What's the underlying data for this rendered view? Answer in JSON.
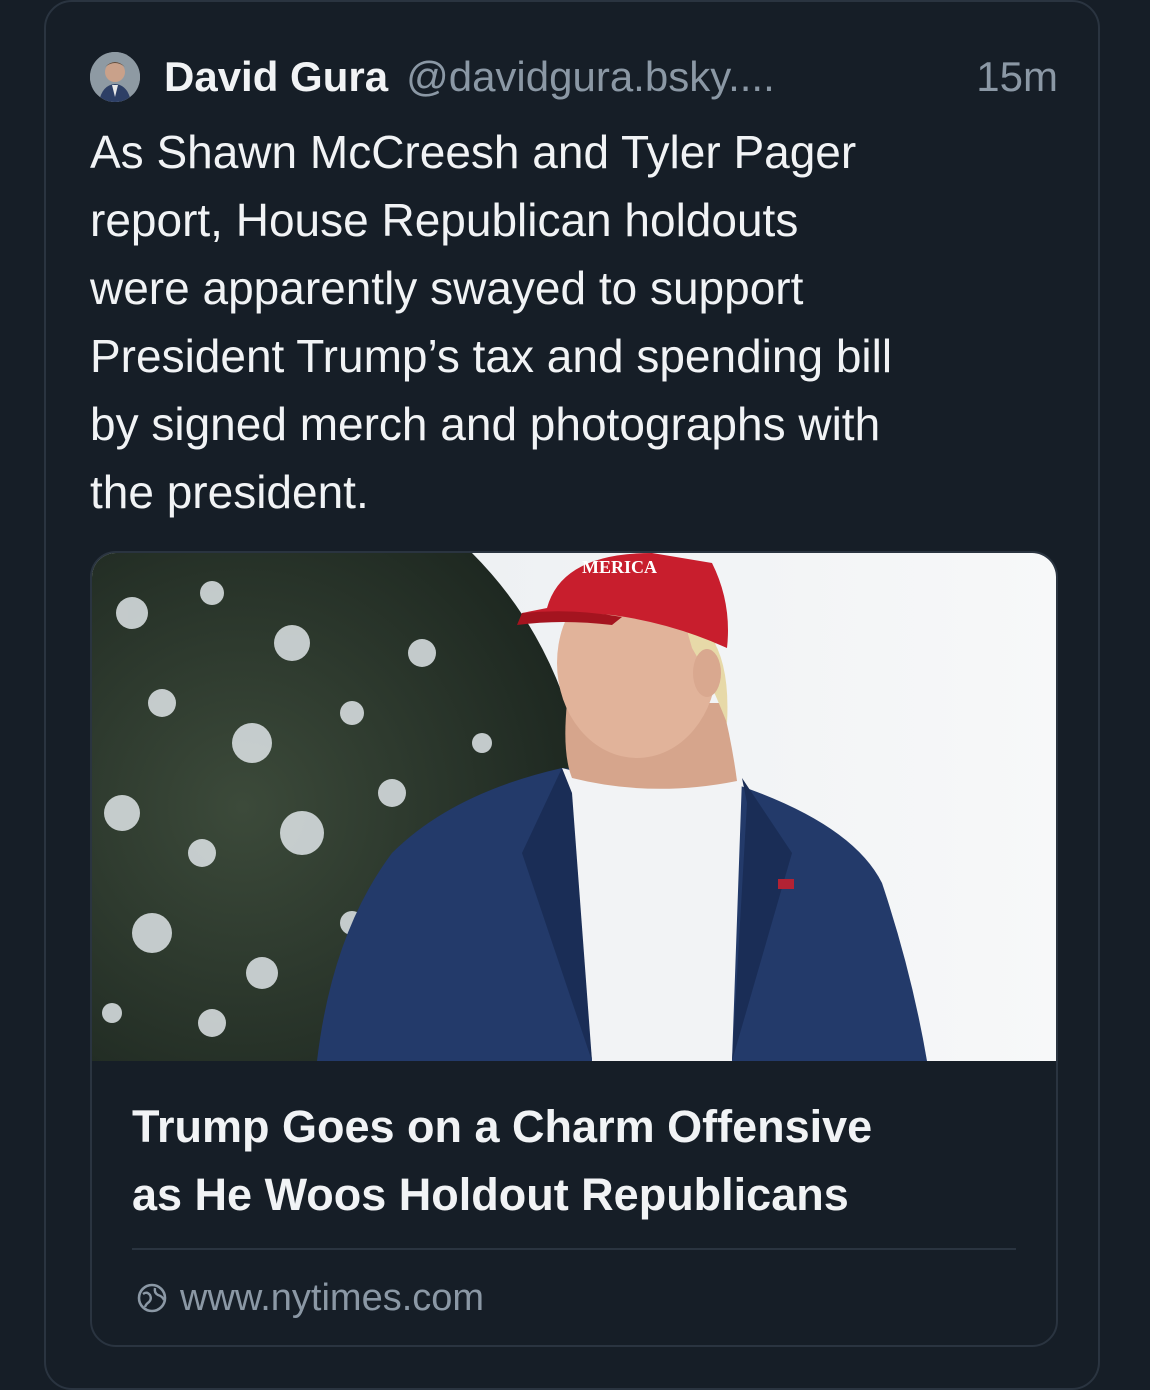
{
  "post": {
    "author_name": "David Gura",
    "author_handle": "@davidgura.bsky....",
    "timestamp": "15m",
    "text_lines": [
      "As Shawn McCreesh and Tyler Pager",
      "report, House Republican holdouts",
      "were apparently swayed to support",
      "President Trump’s tax and spending bill",
      "by signed merch and photographs with",
      "the president."
    ]
  },
  "link_card": {
    "image_caption_visible": "MERICA",
    "title_lines": [
      "Trump Goes on a Charm Offensive",
      "as He Woos Holdout Republicans"
    ],
    "domain": "www.nytimes.com",
    "icon": "globe-icon"
  },
  "colors": {
    "background": "#161e27",
    "border": "#2a3440",
    "text_primary": "#f1f3f5",
    "text_secondary": "#8b98a5"
  }
}
